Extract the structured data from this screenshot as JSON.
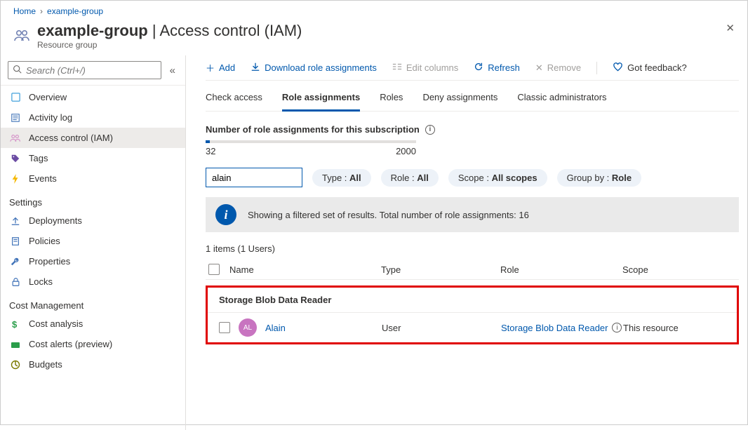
{
  "breadcrumb": {
    "home": "Home",
    "group": "example-group"
  },
  "header": {
    "title_bold": "example-group",
    "title_rest": "Access control (IAM)",
    "subtitle": "Resource group"
  },
  "sidebar": {
    "search_placeholder": "Search (Ctrl+/)",
    "items": [
      {
        "label": "Overview"
      },
      {
        "label": "Activity log"
      },
      {
        "label": "Access control (IAM)"
      },
      {
        "label": "Tags"
      },
      {
        "label": "Events"
      }
    ],
    "settings_label": "Settings",
    "settings": [
      {
        "label": "Deployments"
      },
      {
        "label": "Policies"
      },
      {
        "label": "Properties"
      },
      {
        "label": "Locks"
      }
    ],
    "cost_label": "Cost Management",
    "cost": [
      {
        "label": "Cost analysis"
      },
      {
        "label": "Cost alerts (preview)"
      },
      {
        "label": "Budgets"
      }
    ]
  },
  "toolbar": {
    "add": "Add",
    "download": "Download role assignments",
    "edit_columns": "Edit columns",
    "refresh": "Refresh",
    "remove": "Remove",
    "feedback": "Got feedback?"
  },
  "tabs": {
    "check": "Check access",
    "role_assign": "Role assignments",
    "roles": "Roles",
    "deny": "Deny assignments",
    "classic": "Classic administrators"
  },
  "count": {
    "title": "Number of role assignments for this subscription",
    "min": "32",
    "max": "2000"
  },
  "filters": {
    "search_value": "alain",
    "type_label": "Type : ",
    "type_value": "All",
    "role_label": "Role : ",
    "role_value": "All",
    "scope_label": "Scope : ",
    "scope_value": "All scopes",
    "group_label": "Group by : ",
    "group_value": "Role"
  },
  "banner": "Showing a filtered set of results. Total number of role assignments: 16",
  "items_summary": "1 items (1 Users)",
  "columns": {
    "name": "Name",
    "type": "Type",
    "role": "Role",
    "scope": "Scope"
  },
  "group_header": "Storage Blob Data Reader",
  "row": {
    "avatar": "AL",
    "name": "Alain",
    "type": "User",
    "role": "Storage Blob Data Reader",
    "scope": "This resource"
  }
}
